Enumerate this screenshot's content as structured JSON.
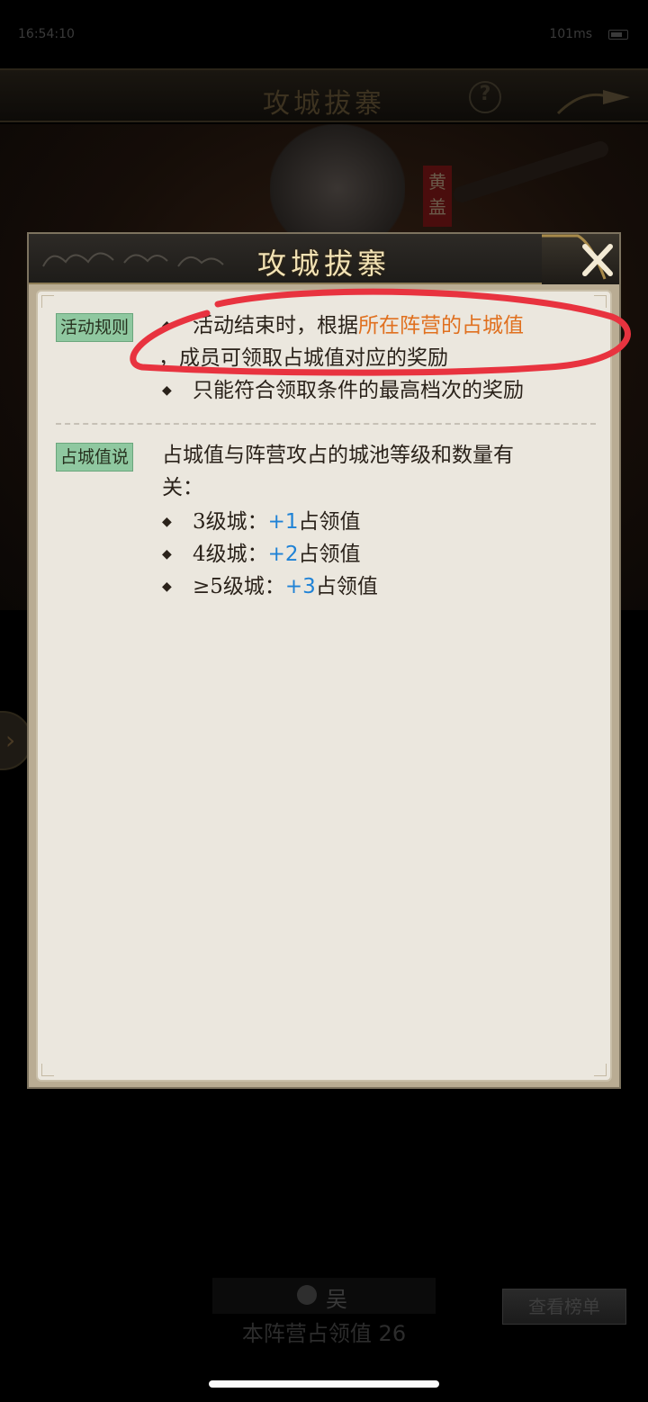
{
  "status_bar": {
    "time": "16:54:10",
    "network": "101ms"
  },
  "game_header": {
    "title": "攻城拔寨",
    "help_label": "?"
  },
  "hero": {
    "name_tag": "黄盖"
  },
  "bottom": {
    "faction_name": "吴",
    "faction_score_label": "本阵营占领值",
    "faction_score_value": "26",
    "rank_button": "查看榜单"
  },
  "dialog": {
    "title": "攻城拔寨",
    "rules": {
      "tag": "活动规则",
      "line1_a": "活动结束时，根据",
      "line1_b": "所在阵营的占城值",
      "line2": "，成员可领取占城值对应的奖励",
      "line3": "只能符合领取条件的最高档次的奖励"
    },
    "occupation": {
      "tag": "占城值说",
      "intro_1": "占城值与阵营攻占的城池等级和数量有",
      "intro_2": "关：",
      "items": [
        {
          "level": "3级城：",
          "points": "+1",
          "suffix": "占领值"
        },
        {
          "level": "4级城：",
          "points": "+2",
          "suffix": "占领值"
        },
        {
          "level": "≥5级城：",
          "points": "+3",
          "suffix": "占领值"
        }
      ]
    }
  },
  "colors": {
    "highlight": "#e0701f",
    "points": "#1f82d6",
    "tag_bg": "#8fc8a0",
    "annotation": "#e8333f"
  }
}
